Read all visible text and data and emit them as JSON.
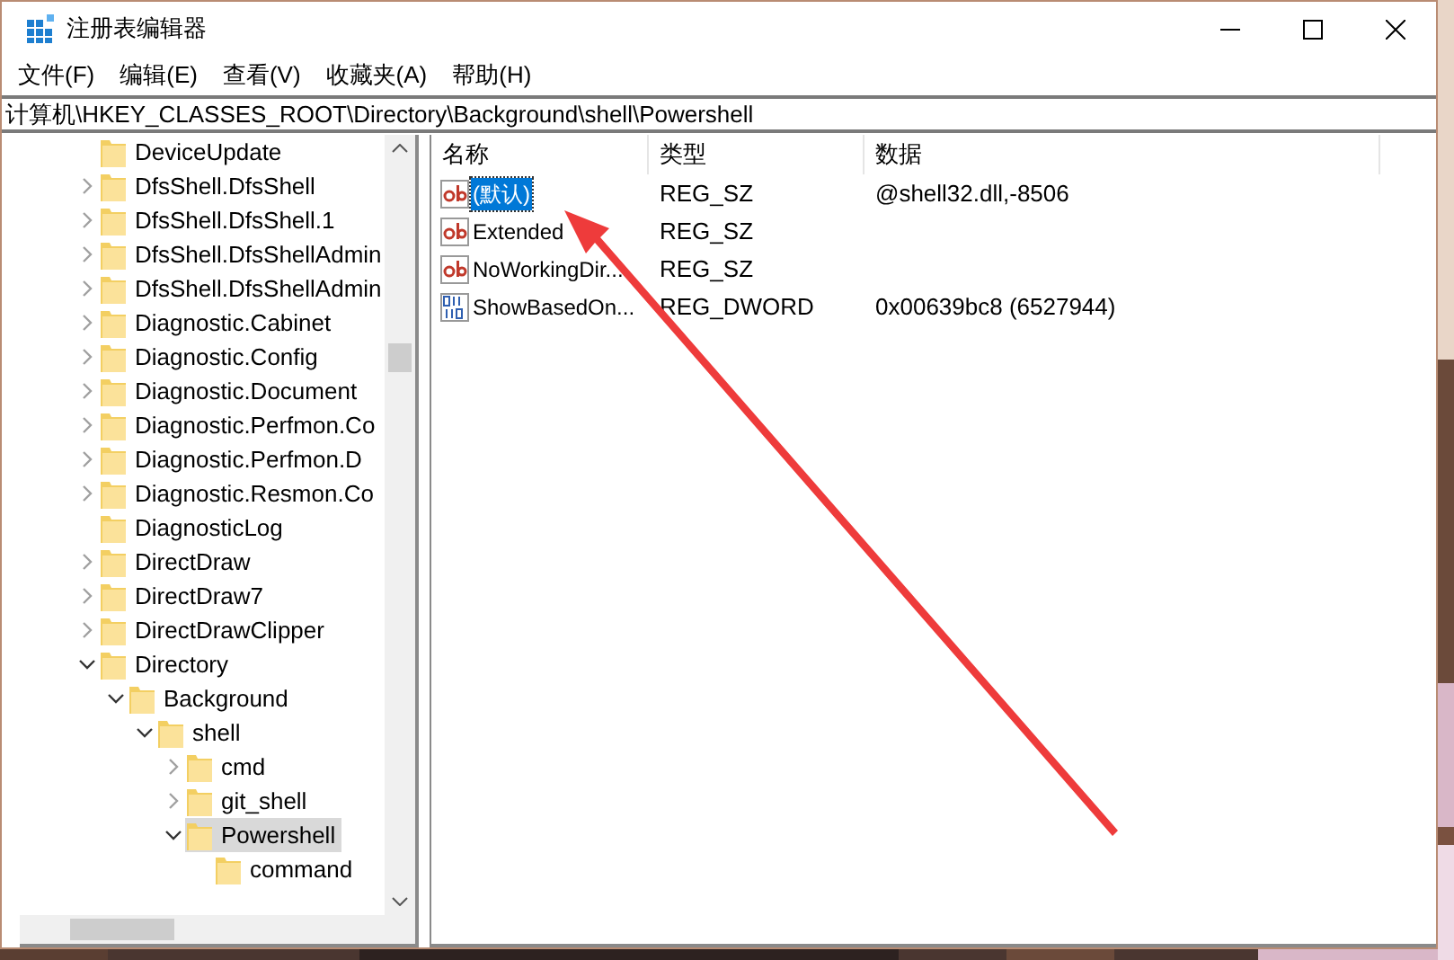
{
  "window": {
    "title": "注册表编辑器"
  },
  "menu": [
    "文件(F)",
    "编辑(E)",
    "查看(V)",
    "收藏夹(A)",
    "帮助(H)"
  ],
  "address": "计算机\\HKEY_CLASSES_ROOT\\Directory\\Background\\shell\\Powershell",
  "tree": [
    {
      "label": "DeviceUpdate",
      "selected": false
    },
    {
      "label": "DfsShell.DfsShell",
      "expanded": false,
      "selected": false
    },
    {
      "label": "DfsShell.DfsShell.1",
      "expanded": false,
      "selected": false
    },
    {
      "label": "DfsShell.DfsShellAdmin",
      "expanded": false,
      "selected": false
    },
    {
      "label": "DfsShell.DfsShellAdmin",
      "expanded": false,
      "selected": false
    },
    {
      "label": "Diagnostic.Cabinet",
      "expanded": false,
      "selected": false
    },
    {
      "label": "Diagnostic.Config",
      "expanded": false,
      "selected": false
    },
    {
      "label": "Diagnostic.Document",
      "expanded": false,
      "selected": false
    },
    {
      "label": "Diagnostic.Perfmon.Co",
      "expanded": false,
      "selected": false
    },
    {
      "label": "Diagnostic.Perfmon.D",
      "expanded": false,
      "selected": false
    },
    {
      "label": "Diagnostic.Resmon.Co",
      "expanded": false,
      "selected": false
    },
    {
      "label": "DiagnosticLog",
      "selected": false
    },
    {
      "label": "DirectDraw",
      "expanded": false,
      "selected": false
    },
    {
      "label": "DirectDraw7",
      "expanded": false,
      "selected": false
    },
    {
      "label": "DirectDrawClipper",
      "expanded": false,
      "selected": false
    },
    {
      "label": "Directory",
      "expanded": true,
      "selected": false,
      "children": [
        {
          "label": "Background",
          "expanded": true,
          "selected": false,
          "children": [
            {
              "label": "shell",
              "expanded": true,
              "selected": false,
              "children": [
                {
                  "label": "cmd",
                  "expanded": false,
                  "selected": false
                },
                {
                  "label": "git_shell",
                  "expanded": false,
                  "selected": false
                },
                {
                  "label": "Powershell",
                  "expanded": true,
                  "selected": true,
                  "children": [
                    {
                      "label": "command",
                      "selected": false
                    }
                  ]
                }
              ]
            }
          ]
        }
      ]
    }
  ],
  "columns": [
    "名称",
    "类型",
    "数据"
  ],
  "values": [
    {
      "kind": "string",
      "name": "(默认)",
      "type": "REG_SZ",
      "data": "@shell32.dll,-8506",
      "selected": true
    },
    {
      "kind": "string",
      "name": "Extended",
      "type": "REG_SZ",
      "selected": false
    },
    {
      "kind": "string",
      "name": "NoWorkingDir...",
      "type": "REG_SZ",
      "selected": false
    },
    {
      "kind": "binary",
      "name": "ShowBasedOn...",
      "type": "REG_DWORD",
      "data": "0x00639bc8 (6527944)",
      "selected": false
    }
  ]
}
